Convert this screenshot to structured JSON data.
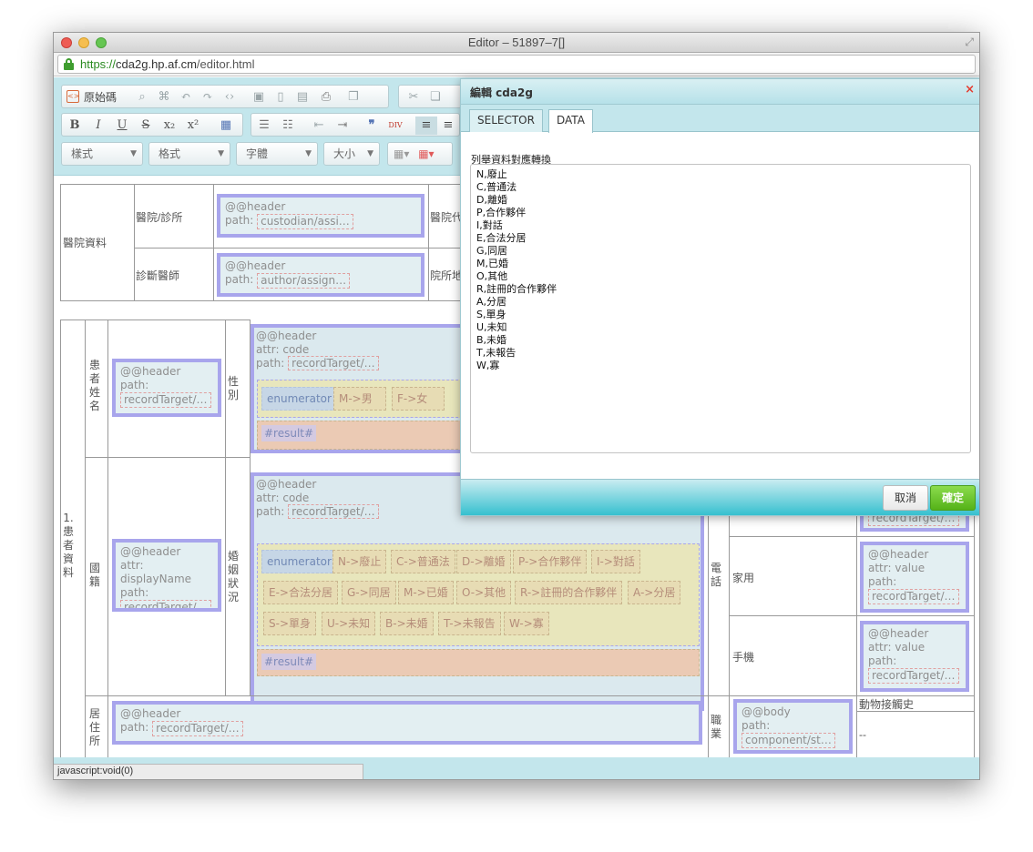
{
  "window": {
    "title": "Editor – 51897–7[]"
  },
  "address": {
    "scheme": "https://",
    "host": "cda2g.hp.af.cm",
    "path": "/editor.html"
  },
  "toolbar": {
    "source_label": "原始碼",
    "combos": [
      "樣式",
      "格式",
      "字體",
      "大小"
    ]
  },
  "doc": {
    "hospital_section": "醫院資料",
    "hospital_clinic": "醫院/診所",
    "hospital_other": "醫院代",
    "doctor": "診斷醫師",
    "clinic_addr": "院所地",
    "patient_section": "1.患者資料",
    "patient_name": "患者姓名",
    "gender": "性別",
    "nationality": "國籍",
    "marital": "婚姻狀況",
    "residence": "居住所",
    "phone": "電話",
    "home": "家用",
    "mobile": "手機",
    "occupation": "職業",
    "animal_contact": "動物接觸史",
    "dash": "--"
  },
  "tags": {
    "header": "@@header",
    "body": "@@body",
    "path": "path:",
    "attr_code": "attr: code",
    "attr_display": "attr: displayName",
    "attr_value": "attr: value",
    "p_custodian": "custodian/assi…",
    "p_author": "author/assign…",
    "p_record": "recordTarget/…",
    "p_component": "component/st…",
    "enumerator": "enumerator",
    "result": "#result#"
  },
  "gender_enum": [
    "M->男",
    "F->女"
  ],
  "marital_enum_rows": [
    [
      "N->廢止",
      "C->普通法",
      "D->離婚",
      "P->合作夥伴",
      "I->對話"
    ],
    [
      "E->合法分居",
      "G->同居",
      "M->已婚",
      "O->其他",
      "R->註冊的合作夥伴",
      "A->分居"
    ],
    [
      "S->單身",
      "U->未知",
      "B->未婚",
      "T->未報告",
      "W->寡"
    ]
  ],
  "dialog": {
    "title": "編輯 cda2g",
    "tabs": [
      "SELECTOR",
      "DATA"
    ],
    "label": "列舉資料對應轉換",
    "data_lines": [
      "N,廢止",
      "C,普通法",
      "D,離婚",
      "P,合作夥伴",
      "I,對話",
      "E,合法分居",
      "G,同居",
      "M,已婚",
      "O,其他",
      "R,註冊的合作夥伴",
      "A,分居",
      "S,單身",
      "U,未知",
      "B,未婚",
      "T,未報告",
      "W,寡"
    ],
    "cancel": "取消",
    "ok": "確定"
  },
  "status": "javascript:void(0)"
}
